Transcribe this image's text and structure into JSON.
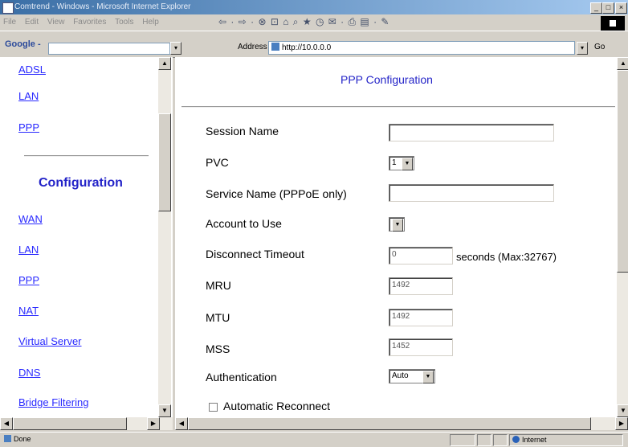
{
  "window": {
    "title": "Comtrend - Windows - Microsoft Internet Explorer",
    "min_label": "_",
    "max_label": "□",
    "close_label": "×"
  },
  "menu": [
    "File",
    "Edit",
    "View",
    "Favorites",
    "Tools",
    "Help"
  ],
  "toolbar": {
    "icons": "⇦ · ⇨ · ⊗ ⊡ ⌂  ⌕ ★ ◷  ✉ · ⎙ ▤ · ✎"
  },
  "google_bar": {
    "label": "Google -",
    "drop": "▾"
  },
  "address": {
    "label": "Address",
    "value": "http://10.0.0.0",
    "drop": "▾",
    "go": "Go"
  },
  "nav": {
    "top_links": [
      "ADSL",
      "LAN",
      "PPP"
    ],
    "section_title": "Configuration",
    "config_links": [
      "WAN",
      "LAN",
      "PPP",
      "NAT",
      "Virtual Server",
      "DNS",
      "Bridge Filtering"
    ]
  },
  "form": {
    "title": "PPP Configuration",
    "session_name": {
      "label": "Session Name",
      "value": ""
    },
    "pvc": {
      "label": "PVC",
      "value": "1"
    },
    "service_name": {
      "label": "Service Name (PPPoE only)",
      "value": ""
    },
    "account": {
      "label": "Account to Use",
      "value": ""
    },
    "disconnect_timeout": {
      "label": "Disconnect Timeout",
      "value": "0",
      "suffix": "seconds (Max:32767)"
    },
    "mru": {
      "label": "MRU",
      "value": "1492"
    },
    "mtu": {
      "label": "MTU",
      "value": "1492"
    },
    "mss": {
      "label": "MSS",
      "value": "1452"
    },
    "authentication": {
      "label": "Authentication",
      "value": "Auto"
    },
    "auto_reconnect": {
      "label": "Automatic Reconnect",
      "checked": false
    }
  },
  "status": {
    "text": "Done",
    "zone": "Internet"
  },
  "scroll_glyphs": {
    "up": "▲",
    "down": "▼",
    "left": "◀",
    "right": "▶"
  }
}
